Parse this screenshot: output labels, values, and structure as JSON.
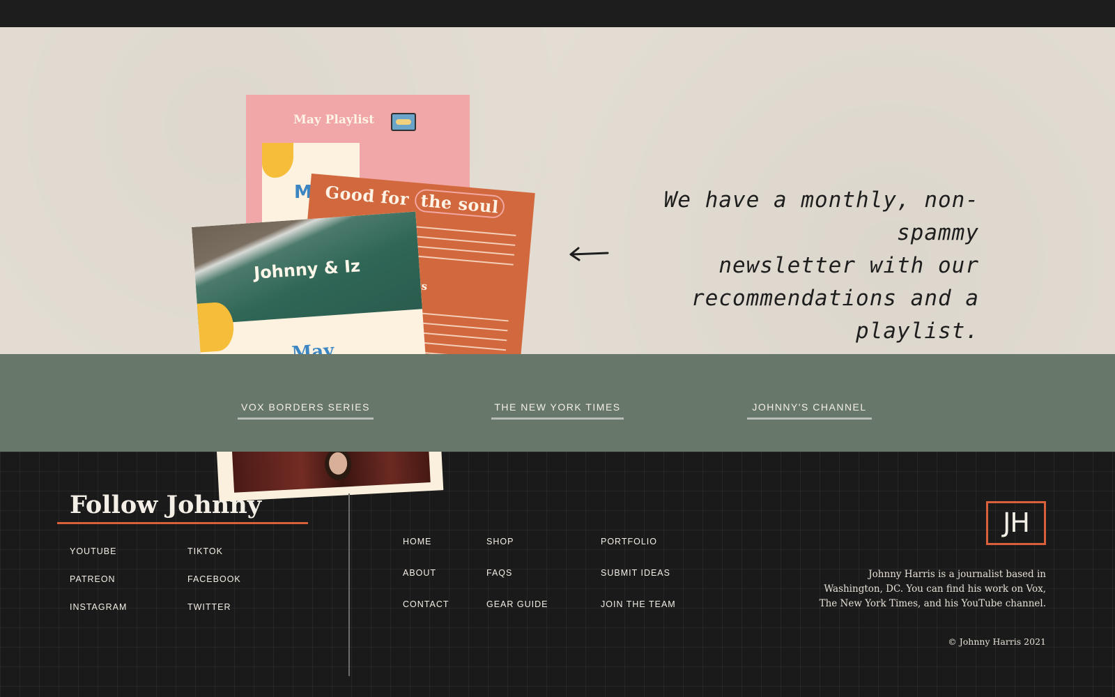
{
  "hero": {
    "card_pink_title": "May Playlist",
    "card_pink_letter": "Ma",
    "card_orange_title_a": "Good for ",
    "card_orange_title_b": "the soul",
    "card_orange_sub": "ings",
    "card_ocean_title": "Johnny & Iz",
    "card_ocean_may": "May",
    "newsletter_line1": "We have a monthly, non-spammy",
    "newsletter_line2": "newsletter with our",
    "newsletter_line3": "recommendations and a playlist."
  },
  "band": {
    "links": [
      {
        "label": "VOX BORDERS SERIES"
      },
      {
        "label": "THE NEW YORK TIMES"
      },
      {
        "label": "JOHNNY'S CHANNEL"
      }
    ]
  },
  "footer": {
    "follow_title": "Follow Johnny",
    "social": {
      "youtube": "YOUTUBE",
      "tiktok": "TIKTOK",
      "patreon": "PATREON",
      "facebook": "FACEBOOK",
      "instagram": "INSTAGRAM",
      "twitter": "TWITTER"
    },
    "nav": {
      "home": "HOME",
      "shop": "SHOP",
      "portfolio": "PORTFOLIO",
      "about": "ABOUT",
      "faqs": "FAQS",
      "submit_ideas": "SUBMIT IDEAS",
      "contact": "CONTACT",
      "gear_guide": "GEAR GUIDE",
      "join_the_team": "JOIN THE TEAM"
    },
    "logo": "JH",
    "bio": "Johnny Harris is a journalist based in Washington, DC. You can find his work on Vox, The New York Times, and his YouTube channel.",
    "copyright": "© Johnny Harris 2021"
  },
  "colors": {
    "accent": "#d9603a",
    "band": "#67776a",
    "hero_bg": "#e3ddd3",
    "footer_bg": "#1a1a1a"
  }
}
